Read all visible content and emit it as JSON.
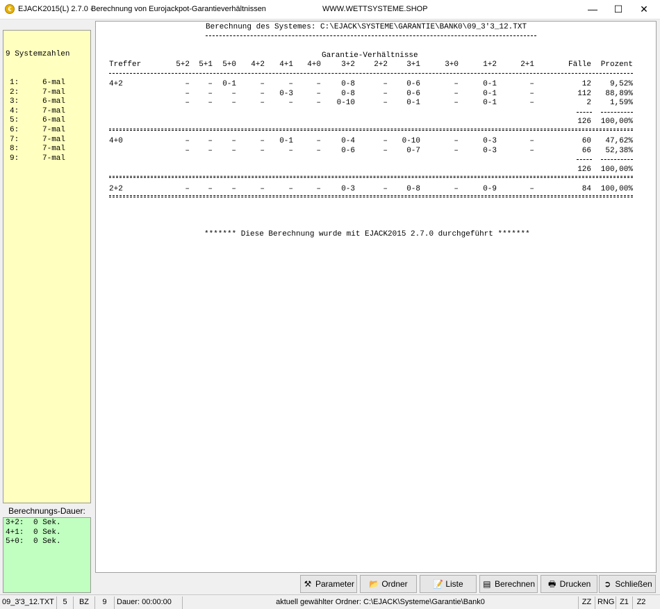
{
  "window": {
    "app_title": "EJACK2015(L) 2.7.0 -",
    "subtitle": "Berechnung von Eurojackpot-Garantieverhältnissen",
    "url": "WWW.WETTSYSTEME.SHOP",
    "app_icon": "€",
    "controls": {
      "minimize": "—",
      "maximize": "☐",
      "close": "✕"
    }
  },
  "left_panel": {
    "zahlen_header": "9 Systemzahlen",
    "zahlen": [
      {
        "num": "1:",
        "val": "6-mal"
      },
      {
        "num": "2:",
        "val": "7-mal"
      },
      {
        "num": "3:",
        "val": "6-mal"
      },
      {
        "num": "4:",
        "val": "7-mal"
      },
      {
        "num": "5:",
        "val": "6-mal"
      },
      {
        "num": "6:",
        "val": "7-mal"
      },
      {
        "num": "7:",
        "val": "7-mal"
      },
      {
        "num": "8:",
        "val": "7-mal"
      },
      {
        "num": "9:",
        "val": "7-mal"
      }
    ],
    "dauer_label": "Berechnungs-Dauer:",
    "dauer": [
      {
        "key": "3+2:",
        "val": "0 Sek."
      },
      {
        "key": "4+1:",
        "val": "0 Sek."
      },
      {
        "key": "5+0:",
        "val": "0 Sek."
      }
    ]
  },
  "report": {
    "header": "Berechnung des Systemes: C:\\EJACK\\SYSTEME\\GARANTIE\\BANK0\\09_3'3_12.TXT",
    "section_title": "Garantie-Verhältnisse",
    "columns": [
      "Treffer",
      "5+2",
      "5+1",
      "5+0",
      "4+2",
      "4+1",
      "4+0",
      "3+2",
      "2+2",
      "3+1",
      "3+0",
      "1+2",
      "2+1",
      "Fälle",
      "Prozent"
    ],
    "groups": [
      {
        "treffer": "4+2",
        "rows": [
          [
            "–",
            "–",
            "0-1",
            "–",
            "–",
            "–",
            "0-8",
            "–",
            "0-6",
            "–",
            "0-1",
            "–",
            "12",
            "9,52%"
          ],
          [
            "–",
            "–",
            "–",
            "–",
            "0-3",
            "–",
            "0-8",
            "–",
            "0-6",
            "–",
            "0-1",
            "–",
            "112",
            "88,89%"
          ],
          [
            "–",
            "–",
            "–",
            "–",
            "–",
            "–",
            "0-10",
            "–",
            "0-1",
            "–",
            "0-1",
            "–",
            "2",
            "1,59%"
          ]
        ],
        "sum_faelle": "126",
        "sum_prozent": "100,00%"
      },
      {
        "treffer": "4+0",
        "rows": [
          [
            "–",
            "–",
            "–",
            "–",
            "0-1",
            "–",
            "0-4",
            "–",
            "0-10",
            "–",
            "0-3",
            "–",
            "60",
            "47,62%"
          ],
          [
            "–",
            "–",
            "–",
            "–",
            "–",
            "–",
            "0-6",
            "–",
            "0-7",
            "–",
            "0-3",
            "–",
            "66",
            "52,38%"
          ]
        ],
        "sum_faelle": "126",
        "sum_prozent": "100,00%"
      },
      {
        "treffer": "2+2",
        "rows": [
          [
            "–",
            "–",
            "–",
            "–",
            "–",
            "–",
            "0-3",
            "–",
            "0-8",
            "–",
            "0-9",
            "–",
            "84",
            "100,00%"
          ]
        ]
      }
    ],
    "footer": "******* Diese Berechnung wurde mit EJACK2015 2.7.0 durchgeführt *******"
  },
  "buttons": [
    {
      "label": "Parameter",
      "icon": "⚒"
    },
    {
      "label": "Ordner",
      "icon": "📂"
    },
    {
      "label": "Liste",
      "icon": "📝"
    },
    {
      "label": "Berechnen",
      "icon": "▤"
    },
    {
      "label": "Drucken",
      "icon": "🖶"
    },
    {
      "label": "Schließen",
      "icon": "➲"
    }
  ],
  "statusbar": {
    "file": "09_3'3_12.TXT",
    "n1": "5",
    "bz": "BZ",
    "n2": "9",
    "dauer": "Dauer: 00:00:00",
    "folder": "aktuell gewählter Ordner: C:\\EJACK\\Systeme\\Garantie\\Bank0",
    "zz": "ZZ",
    "rng": "RNG",
    "z1": "Z1",
    "z2": "Z2"
  }
}
